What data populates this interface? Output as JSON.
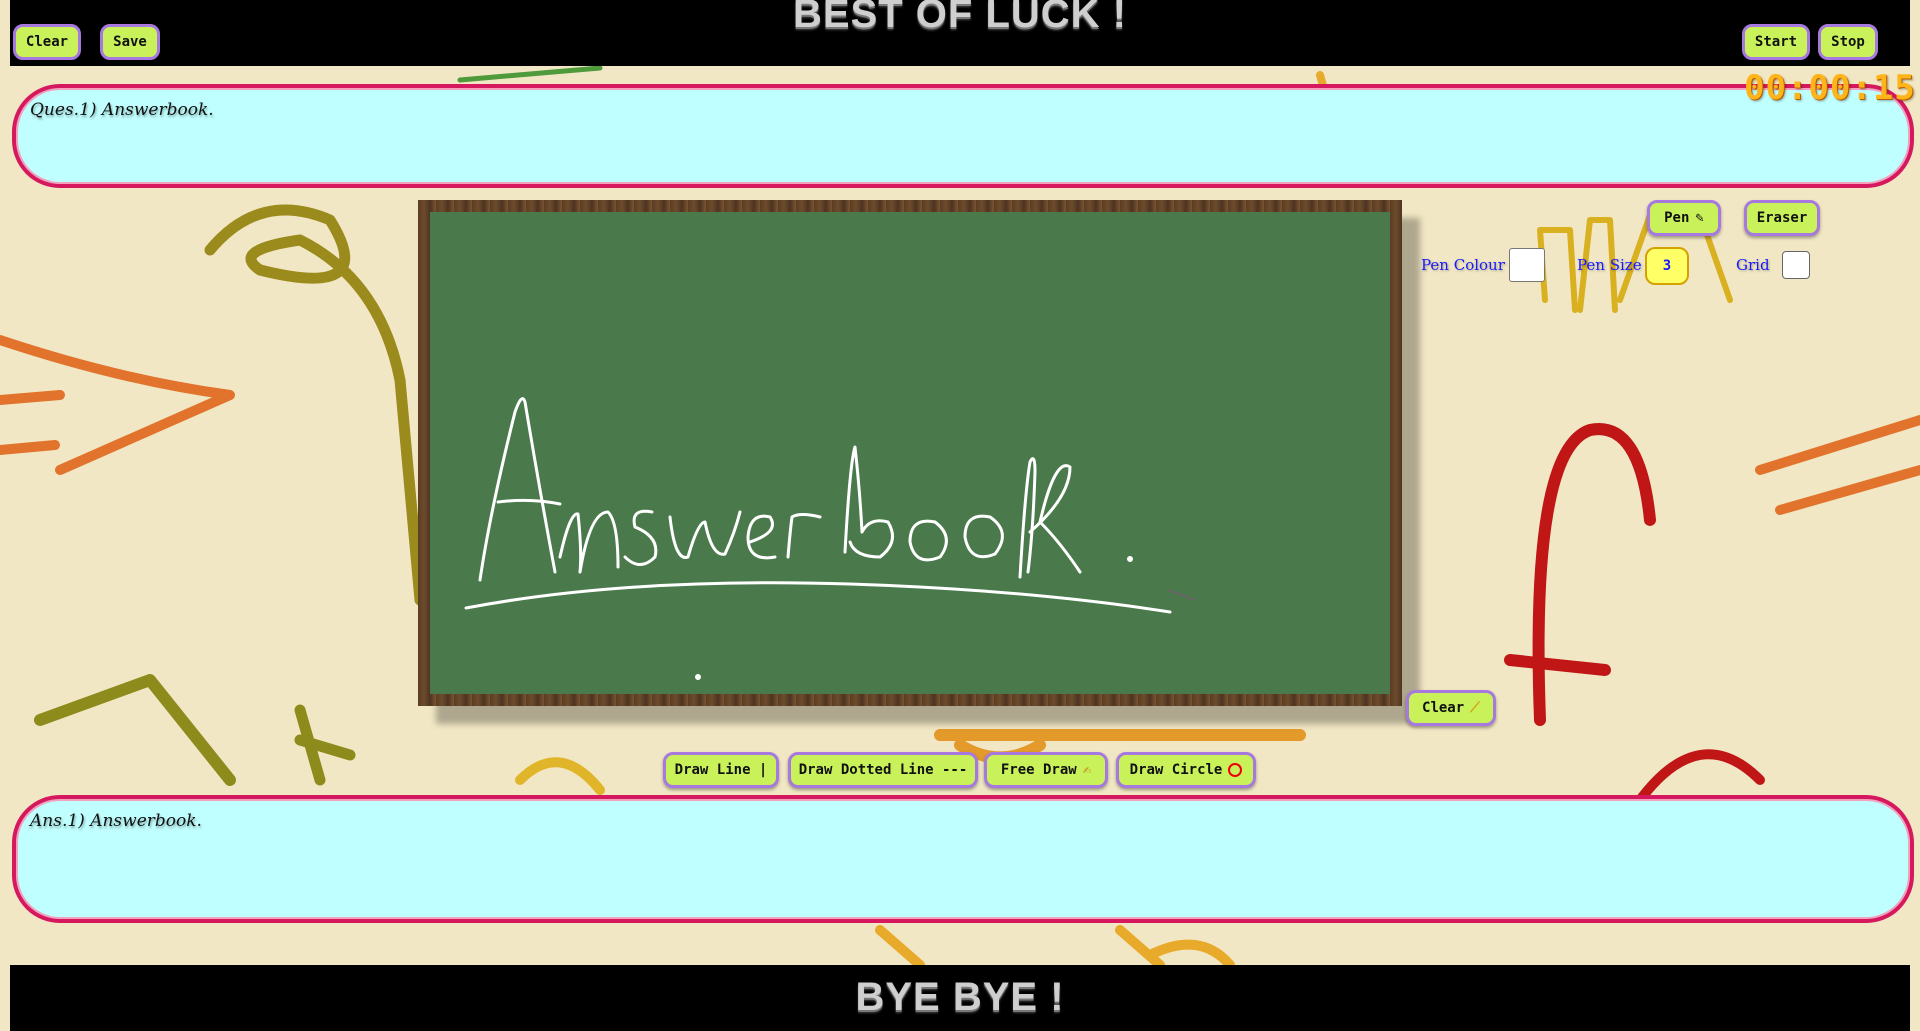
{
  "header": {
    "title": "BEST OF LUCK !",
    "clear_label": "Clear",
    "save_label": "Save",
    "start_label": "Start",
    "stop_label": "Stop"
  },
  "timer": {
    "value": "00:00:15"
  },
  "question": {
    "text": "Ques.1) Answerbook."
  },
  "answer": {
    "text": "Ans.1) Answerbook."
  },
  "board": {
    "background": "#4a7a4c",
    "ink_color": "#ffffff",
    "drawn_text": "Answerbook"
  },
  "tools": {
    "pen_label": "Pen",
    "eraser_label": "Eraser",
    "pen_colour_label": "Pen Colour",
    "pen_colour_value": "#ffffff",
    "pen_size_label": "Pen Size",
    "pen_size_value": "3",
    "grid_label": "Grid",
    "grid_checked": false,
    "board_clear_label": "Clear"
  },
  "draw_modes": {
    "line_label": "Draw Line |",
    "dotted_label": "Draw Dotted Line ---",
    "free_label": "Free Draw",
    "circle_label": "Draw Circle"
  },
  "footer": {
    "title": "BYE BYE !"
  },
  "colors": {
    "button_bg": "#c9f25a",
    "button_border": "#a779e0",
    "textbox_bg": "#c0ffff",
    "textbox_border": "#d6185e",
    "timer": "#ffb41a",
    "label_blue": "#1a1aff"
  }
}
